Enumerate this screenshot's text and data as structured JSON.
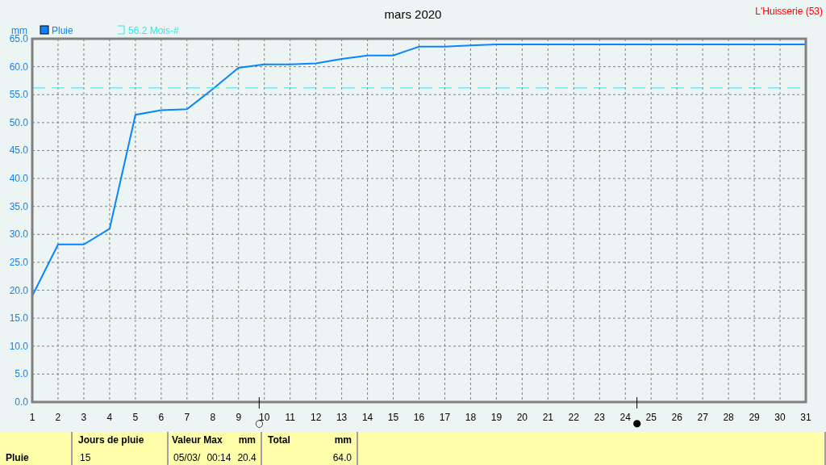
{
  "title": "mars 2020",
  "station": "L'Huisserie (53)",
  "chart": {
    "chart_data": {
      "type": "line",
      "ylabel": "mm",
      "x": [
        1,
        2,
        3,
        4,
        5,
        6,
        7,
        8,
        9,
        10,
        11,
        12,
        13,
        14,
        15,
        16,
        17,
        18,
        19,
        20,
        21,
        22,
        23,
        24,
        25,
        26,
        27,
        28,
        29,
        30,
        31
      ],
      "legend": "top left",
      "series": [
        {
          "name": "Pluie",
          "color": "#0a84ff",
          "line_style": "solid",
          "values": [
            19.0,
            28.2,
            28.2,
            31.0,
            51.4,
            52.2,
            52.4,
            56.0,
            59.8,
            60.4,
            60.4,
            60.6,
            61.4,
            62.0,
            62.0,
            63.6,
            63.6,
            63.8,
            64.0,
            64.0,
            64.0,
            64.0,
            64.0,
            64.0,
            64.0,
            64.0,
            64.0,
            64.0,
            64.0,
            64.0,
            64.0
          ]
        },
        {
          "name": "56.2 Mois-#",
          "color": "#33e6e6",
          "line_style": "dashed",
          "values": [
            56.2,
            56.2,
            56.2,
            56.2,
            56.2,
            56.2,
            56.2,
            56.2,
            56.2,
            56.2,
            56.2,
            56.2,
            56.2,
            56.2,
            56.2,
            56.2,
            56.2,
            56.2,
            56.2,
            56.2,
            56.2,
            56.2,
            56.2,
            56.2,
            56.2,
            56.2,
            56.2,
            56.2,
            56.2,
            56.2,
            56.2
          ]
        }
      ],
      "xlim": [
        1,
        31
      ],
      "ylim": [
        0,
        65
      ],
      "xticks": [
        1,
        2,
        3,
        4,
        5,
        6,
        7,
        8,
        9,
        10,
        11,
        12,
        13,
        14,
        15,
        16,
        17,
        18,
        19,
        20,
        21,
        22,
        23,
        24,
        25,
        26,
        27,
        28,
        29,
        30,
        31
      ],
      "yticks": [
        {
          "value": 0,
          "label": "0.0"
        },
        {
          "value": 5,
          "label": "5.0"
        },
        {
          "value": 10,
          "label": "10.0"
        },
        {
          "value": 15,
          "label": "15.0"
        },
        {
          "value": 20,
          "label": "20.0"
        },
        {
          "value": 25,
          "label": "25.0"
        },
        {
          "value": 30,
          "label": "30.0"
        },
        {
          "value": 35,
          "label": "35.0"
        },
        {
          "value": 40,
          "label": "40.0"
        },
        {
          "value": 45,
          "label": "45.0"
        },
        {
          "value": 50,
          "label": "50.0"
        },
        {
          "value": 55,
          "label": "55.0"
        },
        {
          "value": 60,
          "label": "60.0"
        },
        {
          "value": 65,
          "label": "65.0"
        }
      ],
      "grid": true,
      "annotations": [
        "○",
        "●"
      ]
    }
  },
  "summary": {
    "row_label": "Pluie",
    "columns": [
      {
        "header": "Jours de pluie",
        "values": [
          "15"
        ]
      },
      {
        "header": "Valeur Max",
        "unit": "mm",
        "values": [
          "05/03/",
          "00:14",
          "20.4"
        ]
      },
      {
        "header": "Total",
        "unit": "mm",
        "values": [
          "64.0"
        ]
      }
    ]
  }
}
